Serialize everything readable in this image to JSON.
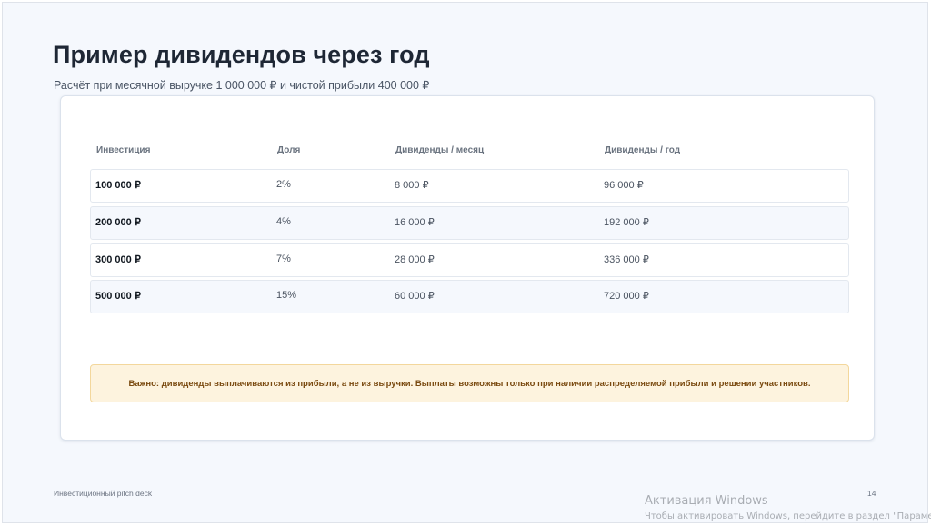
{
  "slide": {
    "title": "Пример дивидендов через год",
    "subtitle": "Расчёт при месячной выручке 1 000 000 ₽ и чистой прибыли 400 000 ₽",
    "table": {
      "headers": [
        "Инвестиция",
        "Доля",
        "Дивиденды / месяц",
        "Дивиденды / год"
      ],
      "rows": [
        [
          "100 000 ₽",
          "2%",
          "8 000 ₽",
          "96 000 ₽"
        ],
        [
          "200 000 ₽",
          "4%",
          "16 000 ₽",
          "192 000 ₽"
        ],
        [
          "300 000 ₽",
          "7%",
          "28 000 ₽",
          "336 000 ₽"
        ],
        [
          "500 000 ₽",
          "15%",
          "60 000 ₽",
          "720 000 ₽"
        ]
      ]
    },
    "notice": "Важно: дивиденды выплачиваются из прибыли, а не из выручки. Выплаты возможны только при наличии распределяемой прибыли и решении участников.",
    "footer_left": "Инвестиционный pitch deck",
    "page_number": "14"
  },
  "watermark": {
    "title": "Активация Windows",
    "subtitle": "Чтобы активировать Windows, перейдите в раздел \"Параметры\"."
  },
  "colors": {
    "slide_background": "#f5f8fd",
    "notice_background": "#fdf3de",
    "notice_text": "#7a4a10",
    "title_text": "#1e2735"
  }
}
